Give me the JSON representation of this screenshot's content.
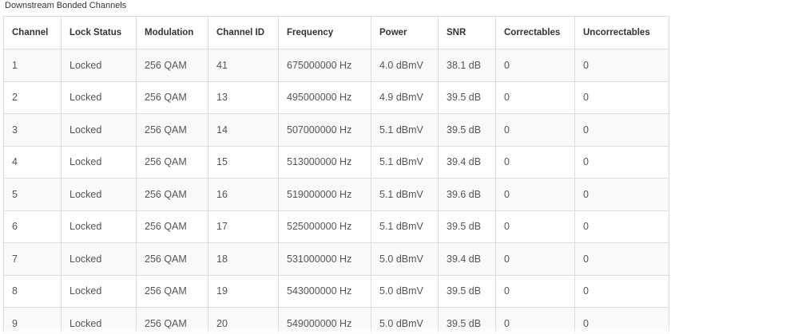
{
  "section": {
    "title": "Downstream Bonded Channels"
  },
  "table": {
    "headers": [
      "Channel",
      "Lock Status",
      "Modulation",
      "Channel ID",
      "Frequency",
      "Power",
      "SNR",
      "Correctables",
      "Uncorrectables"
    ],
    "rows": [
      [
        "1",
        "Locked",
        "256 QAM",
        "41",
        "675000000 Hz",
        "4.0 dBmV",
        "38.1 dB",
        "0",
        "0"
      ],
      [
        "2",
        "Locked",
        "256 QAM",
        "13",
        "495000000 Hz",
        "4.9 dBmV",
        "39.5 dB",
        "0",
        "0"
      ],
      [
        "3",
        "Locked",
        "256 QAM",
        "14",
        "507000000 Hz",
        "5.1 dBmV",
        "39.5 dB",
        "0",
        "0"
      ],
      [
        "4",
        "Locked",
        "256 QAM",
        "15",
        "513000000 Hz",
        "5.1 dBmV",
        "39.4 dB",
        "0",
        "0"
      ],
      [
        "5",
        "Locked",
        "256 QAM",
        "16",
        "519000000 Hz",
        "5.1 dBmV",
        "39.6 dB",
        "0",
        "0"
      ],
      [
        "6",
        "Locked",
        "256 QAM",
        "17",
        "525000000 Hz",
        "5.1 dBmV",
        "39.5 dB",
        "0",
        "0"
      ],
      [
        "7",
        "Locked",
        "256 QAM",
        "18",
        "531000000 Hz",
        "5.0 dBmV",
        "39.4 dB",
        "0",
        "0"
      ],
      [
        "8",
        "Locked",
        "256 QAM",
        "19",
        "543000000 Hz",
        "5.0 dBmV",
        "39.5 dB",
        "0",
        "0"
      ],
      [
        "9",
        "Locked",
        "256 QAM",
        "20",
        "549000000 Hz",
        "5.0 dBmV",
        "39.5 dB",
        "0",
        "0"
      ]
    ]
  }
}
